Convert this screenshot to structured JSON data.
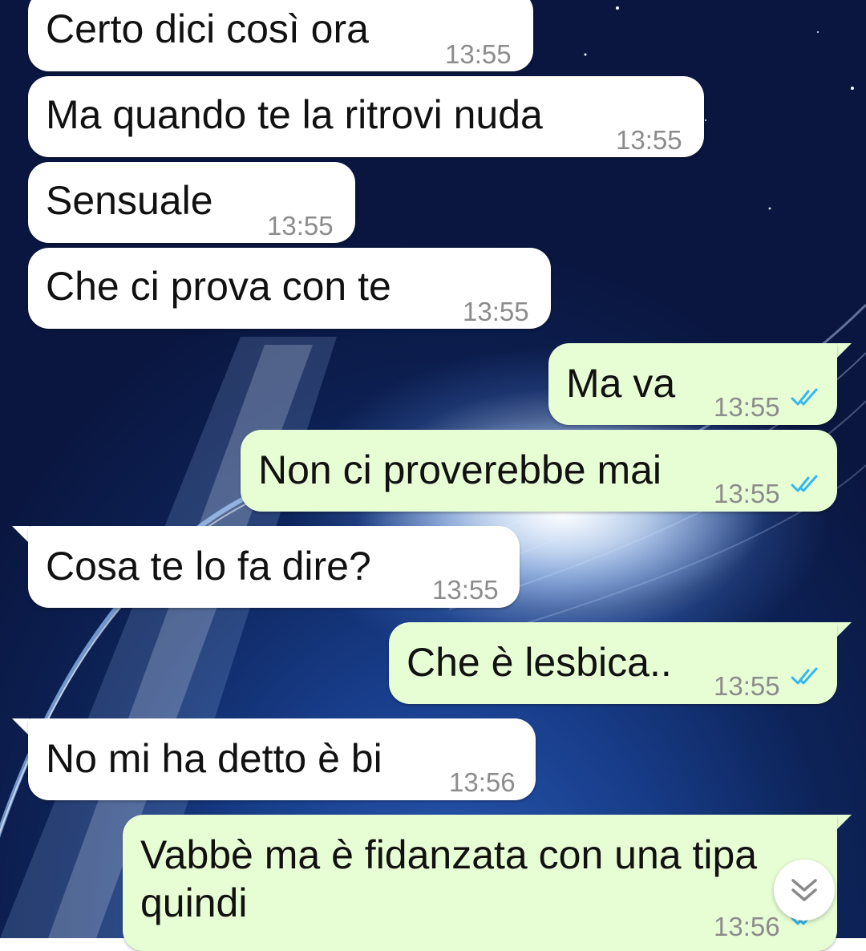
{
  "messages": [
    {
      "text": "Certo dici così ora",
      "time": "13:55",
      "direction": "incoming"
    },
    {
      "text": "Ma quando te la ritrovi nuda",
      "time": "13:55",
      "direction": "incoming"
    },
    {
      "text": "Sensuale",
      "time": "13:55",
      "direction": "incoming"
    },
    {
      "text": "Che ci prova con te",
      "time": "13:55",
      "direction": "incoming"
    },
    {
      "text": "Ma va",
      "time": "13:55",
      "direction": "outgoing",
      "status": "read"
    },
    {
      "text": "Non ci proverebbe mai",
      "time": "13:55",
      "direction": "outgoing",
      "status": "read"
    },
    {
      "text": "Cosa te lo fa dire?",
      "time": "13:55",
      "direction": "incoming"
    },
    {
      "text": "Che è lesbica..",
      "time": "13:55",
      "direction": "outgoing",
      "status": "read"
    },
    {
      "text": "No mi ha detto è bi",
      "time": "13:56",
      "direction": "incoming"
    },
    {
      "text_line1": "Vabbè ma è fidanzata con una tipa",
      "text_line2": "quindi",
      "time": "13:56",
      "direction": "outgoing",
      "status": "read"
    }
  ],
  "icons": {
    "read_receipt": "double-check-icon",
    "scroll_down": "double-chevron-down-icon"
  },
  "colors": {
    "incoming_bubble": "#ffffff",
    "outgoing_bubble": "#e7fed5",
    "read_tick": "#34b7f1",
    "timestamp": "#8c8c8c"
  }
}
